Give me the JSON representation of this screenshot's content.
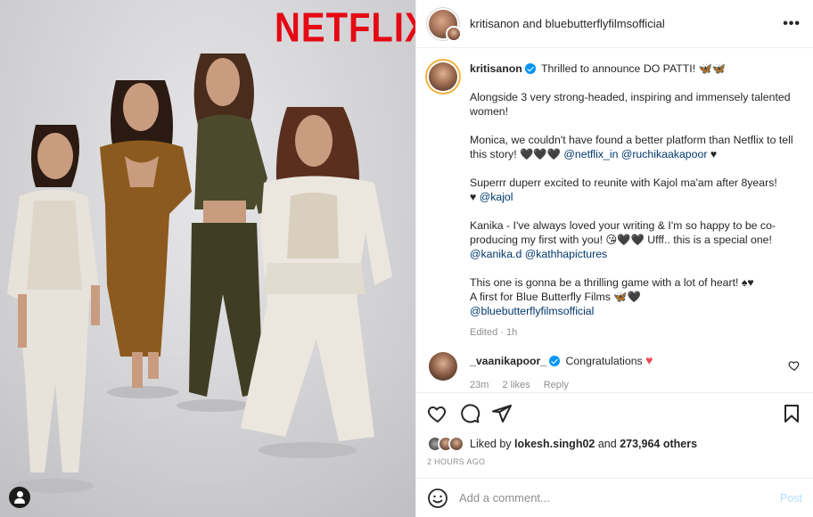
{
  "photo": {
    "logo_text": "NETFLIX"
  },
  "header": {
    "title": "kritisanon and bluebutterflyfilmsofficial",
    "more_label": "•••"
  },
  "caption": {
    "username": "kritisanon",
    "line1": "Thrilled to announce DO PATTI! 🦋🦋",
    "para2": "Alongside 3 very strong-headed, inspiring and immensely talented women!",
    "para3_text": "Monica, we couldn't have found a better platform than Netflix to tell this story! ",
    "para3_emoji": "🖤🖤🖤",
    "para3_mention1": "@netflix_in",
    "para3_mention2": "@ruchikaakapoor",
    "para3_end": "♥",
    "para4_text": "Superrr duperr excited to reunite with Kajol ma'am after 8years!",
    "para4_heart": "♥",
    "para4_mention": "@kajol",
    "para5_text": "Kanika - I've always loved your writing & I'm so happy to be co-producing my first with you! 😘🖤🖤 Ufff.. this is a special one!",
    "para5_mention1": "@kanika.d",
    "para5_mention2": "@kathhapictures",
    "para6_line1": "This one is gonna be a thrilling game with a lot of heart! ♠♥",
    "para6_line2": "A first for Blue Butterfly Films 🦋🖤",
    "para6_mention": "@bluebutterflyfilmsofficial",
    "meta": "Edited · 1h"
  },
  "comment": {
    "username": "_vaanikapoor_",
    "text": "Congratulations",
    "heart": "♥",
    "time": "23m",
    "likes": "2 likes",
    "reply": "Reply"
  },
  "likes": {
    "prefix": "Liked by",
    "user": "lokesh.singh02",
    "conj": "and",
    "count": "273,964 others"
  },
  "timestamp": "2 HOURS AGO",
  "add_comment": {
    "placeholder": "Add a comment...",
    "post_label": "Post"
  },
  "colors": {
    "netflix_red": "#e50914",
    "link": "#00376b",
    "verified": "#0095f6",
    "post_disabled": "#b2dffc"
  }
}
